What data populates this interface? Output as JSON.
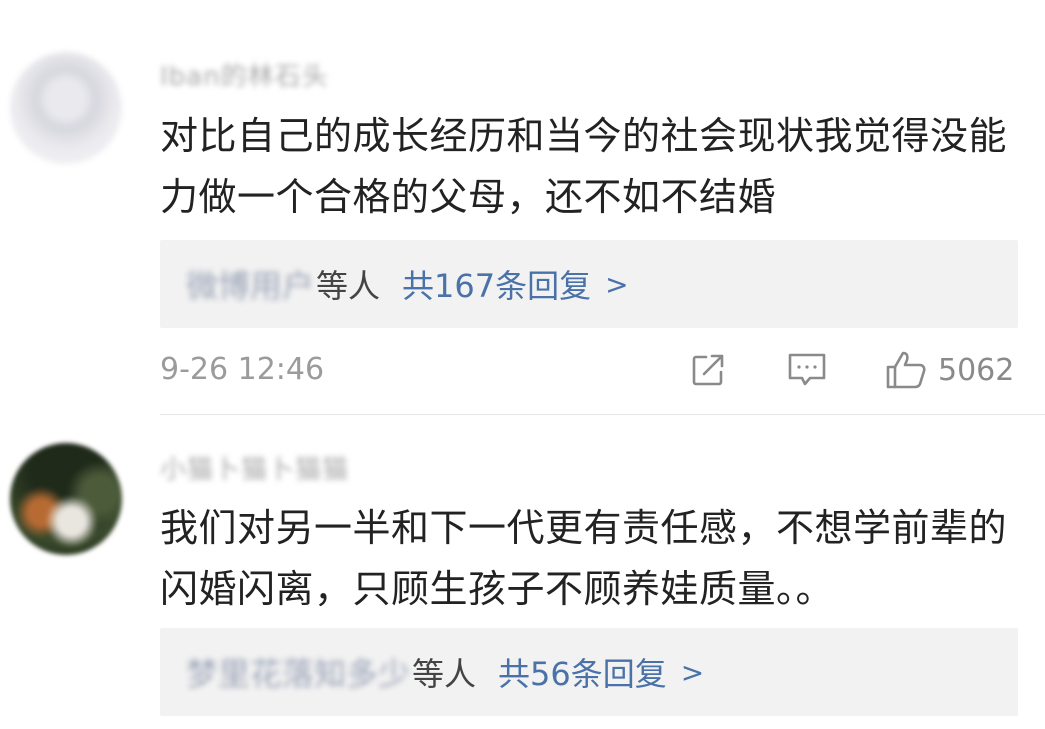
{
  "comments": [
    {
      "username": "Iban的林石头",
      "text_lines": [
        "对比自己的成长经历和当今的社会现状我觉得没能",
        "力做一个合格的父母，还不如不结婚"
      ],
      "reply_names": "微博用户",
      "reply_suffix": "等人",
      "reply_count": "共167条回复",
      "reply_arrow": ">",
      "time": "9-26 12:46",
      "likes": "5062",
      "icons": [
        "share-icon",
        "comment-icon",
        "like-icon"
      ]
    },
    {
      "username": "小猫卜猫卜猫猫",
      "text_lines": [
        "我们对另一半和下一代更有责任感，不想学前辈的",
        "闪婚闪离，只顾生孩子不顾养娃质量。。"
      ],
      "reply_names": "梦里花落知多少",
      "reply_suffix": "等人",
      "reply_count": "共56条回复",
      "reply_arrow": ">"
    }
  ],
  "colors": {
    "link": "#4a72a8",
    "text": "#222222",
    "muted": "#9b9b9b",
    "reply_bg": "#f2f2f2"
  }
}
